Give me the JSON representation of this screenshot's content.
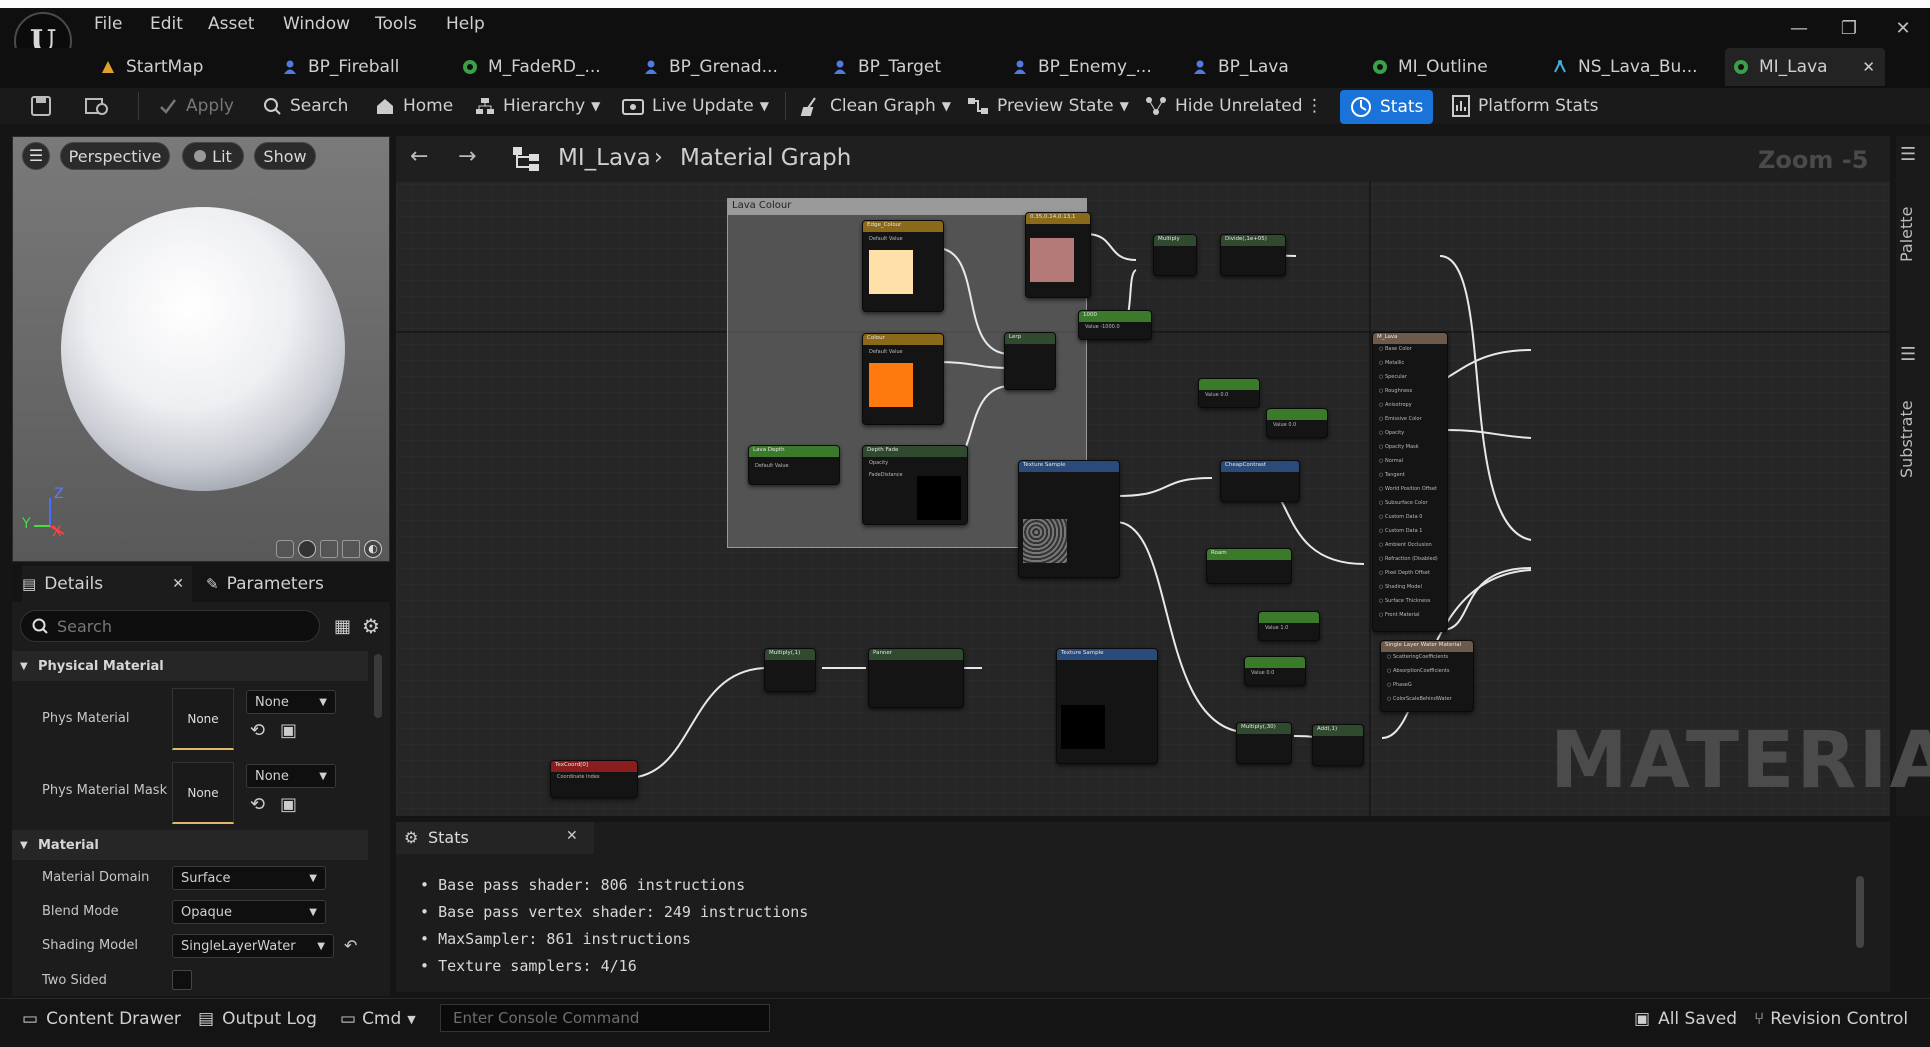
{
  "app": {
    "logo_glyph": "U"
  },
  "menu": [
    "File",
    "Edit",
    "Asset",
    "Window",
    "Tools",
    "Help"
  ],
  "tabs": [
    {
      "label": "StartMap",
      "icon": "level-icon"
    },
    {
      "label": "BP_Fireball",
      "icon": "blueprint-icon"
    },
    {
      "label": "M_FadeRD_...",
      "icon": "material-icon"
    },
    {
      "label": "BP_Grenad...",
      "icon": "blueprint-icon"
    },
    {
      "label": "BP_Target",
      "icon": "blueprint-icon"
    },
    {
      "label": "BP_Enemy_...",
      "icon": "blueprint-icon"
    },
    {
      "label": "BP_Lava",
      "icon": "blueprint-icon"
    },
    {
      "label": "MI_Outline",
      "icon": "material-icon"
    },
    {
      "label": "NS_Lava_Bu...",
      "icon": "niagara-icon"
    },
    {
      "label": "MI_Lava",
      "icon": "material-icon",
      "active": true
    }
  ],
  "toolbar": {
    "apply": "Apply",
    "search": "Search",
    "home": "Home",
    "hierarchy": "Hierarchy",
    "live_update": "Live Update",
    "clean_graph": "Clean Graph",
    "preview_state": "Preview State",
    "hide_unrelated": "Hide Unrelated",
    "stats": "Stats",
    "platform_stats": "Platform Stats"
  },
  "viewport": {
    "perspective": "Perspective",
    "lit": "Lit",
    "show": "Show",
    "axis_z": "Z",
    "axis_x": "X",
    "axis_y": "Y"
  },
  "details": {
    "tab_details": "Details",
    "tab_parameters": "Parameters",
    "search_placeholder": "Search",
    "section_physical": "Physical Material",
    "phys_material": "Phys Material",
    "phys_material_value": "None",
    "phys_material_dropdown": "None",
    "phys_material_mask": "Phys Material Mask",
    "phys_material_mask_value": "None",
    "phys_material_mask_dropdown": "None",
    "section_material": "Material",
    "material_domain": "Material Domain",
    "material_domain_value": "Surface",
    "blend_mode": "Blend Mode",
    "blend_mode_value": "Opaque",
    "shading_model": "Shading Model",
    "shading_model_value": "SingleLayerWater",
    "two_sided": "Two Sided"
  },
  "graph": {
    "breadcrumb_root": "MI_Lava",
    "breadcrumb_leaf": "Material Graph",
    "zoom": "Zoom -5",
    "watermark": "MATERIAL",
    "comment_title": "Lava Colour",
    "side_palette": "Palette",
    "side_substrate": "Substrate",
    "nodes": {
      "edge_colour": "Edge_Colour",
      "colour": "Colour",
      "lava_depth": "Lava Depth",
      "depth_fade": "Depth Fade",
      "lerp": "Lerp",
      "constant": "0.35,0.14,0.13,1",
      "multiply": "Multiply",
      "divide": "Divide(,1e+05)",
      "const_1000": "1000",
      "texture_sample": "Texture Sample",
      "cheap_contrast": "CheapContrast",
      "roam": "Roam",
      "multiply_1": "Multiply(,1)",
      "panner": "Panner",
      "texture_sample_2": "Texture Sample",
      "texcoord": "TexCoord[0]",
      "multiply_30": "Multiply(,30)",
      "add": "Add(,1)",
      "m_lava": "M_Lava",
      "single_layer_water": "Single Layer Water Material",
      "default_value": "Default Value",
      "opacity": "Opacity",
      "fade_distance": "FadeDistance",
      "value_0": "Value 0.0",
      "value_1000": "Value -1000.0",
      "value_1": "Value 1.0",
      "coordinate_index": "Coordinate Index",
      "pins": [
        "Base Color",
        "Metallic",
        "Specular",
        "Roughness",
        "Anisotropy",
        "Emissive Color",
        "Opacity",
        "Opacity Mask",
        "Normal",
        "Tangent",
        "World Position Offset",
        "Subsurface Color",
        "Custom Data 0",
        "Custom Data 1",
        "Ambient Occlusion",
        "Refraction (Disabled)",
        "Pixel Depth Offset",
        "Shading Model",
        "Surface Thickness",
        "Front Material"
      ],
      "water_pins": [
        "ScatteringCoefficients",
        "AbsorptionCoefficients",
        "PhaseG",
        "ColorScaleBehindWater"
      ]
    }
  },
  "stats": {
    "tab": "Stats",
    "lines": [
      "Base pass shader: 806 instructions",
      "Base pass vertex shader: 249 instructions",
      "MaxSampler: 861 instructions",
      "Texture samplers: 4/16"
    ]
  },
  "bottom": {
    "content_drawer": "Content Drawer",
    "output_log": "Output Log",
    "cmd": "Cmd",
    "console_placeholder": "Enter Console Command",
    "all_saved": "All Saved",
    "revision_control": "Revision Control"
  },
  "colors": {
    "accent": "#1a73d9",
    "orange": "#ff7a0e",
    "peach": "#ffe0a8",
    "pink": "#b47a78"
  }
}
